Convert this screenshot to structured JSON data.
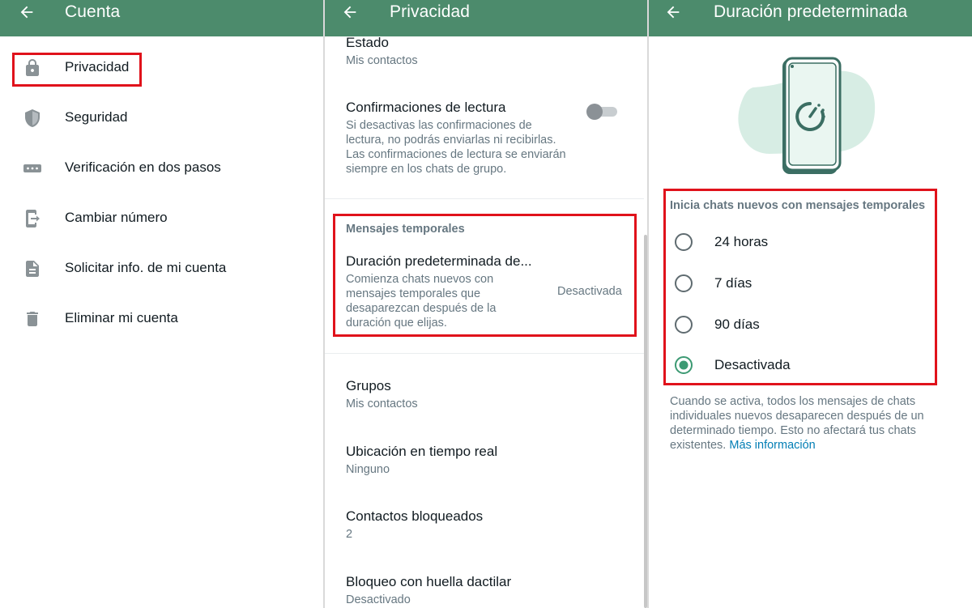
{
  "panels": {
    "account": {
      "title": "Cuenta",
      "items": [
        {
          "label": "Privacidad",
          "icon": "lock-icon"
        },
        {
          "label": "Seguridad",
          "icon": "shield-icon"
        },
        {
          "label": "Verificación en dos pasos",
          "icon": "dots-icon"
        },
        {
          "label": "Cambiar número",
          "icon": "change-number-icon"
        },
        {
          "label": "Solicitar info. de mi cuenta",
          "icon": "document-icon"
        },
        {
          "label": "Eliminar mi cuenta",
          "icon": "trash-icon"
        }
      ]
    },
    "privacy": {
      "title": "Privacidad",
      "estado": {
        "title": "Estado",
        "value": "Mis contactos"
      },
      "read_receipts": {
        "title": "Confirmaciones de lectura",
        "desc": [
          "Si desactivas las confirmaciones de",
          "lectura, no podrás enviarlas ni recibirlas.",
          "Las confirmaciones de lectura se enviarán",
          "siempre en los chats de grupo."
        ],
        "enabled": false
      },
      "temp_section": "Mensajes temporales",
      "default_duration": {
        "title": "Duración predeterminada de...",
        "desc": [
          "Comienza chats nuevos con",
          "mensajes temporales que",
          "desaparezcan después de la",
          "duración que elijas."
        ],
        "value": "Desactivada"
      },
      "grupos": {
        "title": "Grupos",
        "value": "Mis contactos"
      },
      "live_location": {
        "title": "Ubicación en tiempo real",
        "value": "Ninguno"
      },
      "blocked": {
        "title": "Contactos bloqueados",
        "value": "2"
      },
      "fingerprint": {
        "title": "Bloqueo con huella dactilar",
        "value": "Desactivado"
      }
    },
    "duration": {
      "title": "Duración predeterminada",
      "header": "Inicia chats nuevos con mensajes temporales",
      "options": [
        {
          "label": "24 horas",
          "selected": false
        },
        {
          "label": "7 días",
          "selected": false
        },
        {
          "label": "90 días",
          "selected": false
        },
        {
          "label": "Desactivada",
          "selected": true
        }
      ],
      "note": [
        "Cuando se activa, todos los mensajes de chats",
        "individuales nuevos desaparecen después de un",
        "determinado tiempo. Esto no afectará tus chats",
        "existentes."
      ],
      "link": "Más información"
    }
  },
  "colors": {
    "appbar": "#4c8b6c",
    "accent": "#3c9a73",
    "highlight": "#e0121b",
    "link": "#027eb5",
    "icon": "#8a9296"
  }
}
